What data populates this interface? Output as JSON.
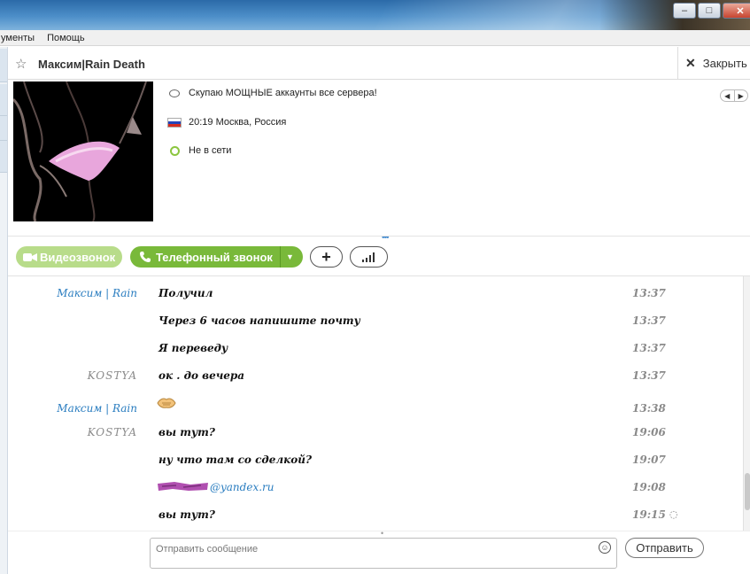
{
  "menu": {
    "items": [
      "ументы",
      "Помощь"
    ]
  },
  "header": {
    "contact_name": "Максим|Rain Death",
    "close_label": "Закрыть"
  },
  "profile": {
    "mood": "Скупаю МОЩНЫЕ аккаунты все сервера!",
    "local_time": "20:19 Москва, Россия",
    "status": "Не в сети"
  },
  "call": {
    "video_label": "Видеозвонок",
    "phone_label": "Телефонный звонок"
  },
  "messages": [
    {
      "sender": "Максим | Rain",
      "text": "Получил",
      "time": "13:37"
    },
    {
      "sender": "",
      "text": "Через 6 часов напишите почту",
      "time": "13:37"
    },
    {
      "sender": "",
      "text": "Я переведу",
      "time": "13:37"
    },
    {
      "sender": "KOSTYA",
      "text": "ок . до вечера",
      "time": "13:37"
    },
    {
      "sender": "Максим | Rain",
      "text": "",
      "time": "13:38"
    },
    {
      "sender": "KOSTYA",
      "text": "вы тут?",
      "time": "19:06"
    },
    {
      "sender": "",
      "text": "ну что там со сделкой?",
      "time": "19:07"
    },
    {
      "sender": "",
      "text": "@yandex.ru",
      "time": "19:08"
    },
    {
      "sender": "",
      "text": "вы тут?",
      "time": "19:15"
    }
  ],
  "composer": {
    "placeholder": "Отправить сообщение",
    "send_label": "Отправить"
  },
  "colors": {
    "accent_green": "#79b93a",
    "link_blue": "#2a7dc0",
    "redaction": "#b04fb0"
  }
}
